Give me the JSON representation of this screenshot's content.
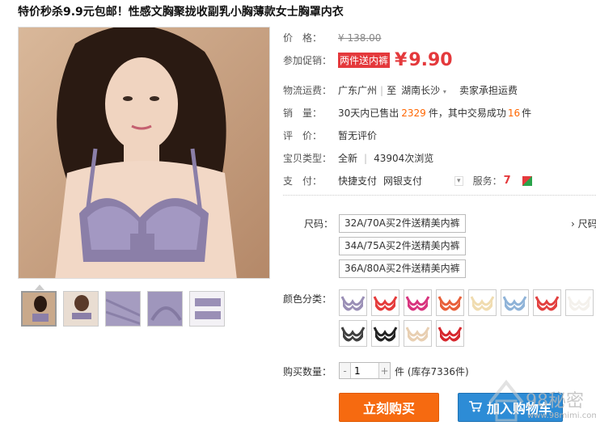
{
  "product": {
    "title": "特价秒杀9.9元包邮！性感文胸聚拢收副乳小胸薄款女士胸罩内衣"
  },
  "price_row": {
    "label": "价　格：",
    "old_price": "¥ 138.00"
  },
  "promo_row": {
    "label": "参加促销：",
    "badge": "两件送内裤",
    "currency": "¥",
    "price": "9.90"
  },
  "shipping_row": {
    "label": "物流运费：",
    "from": "广东广州",
    "to_prefix": "至",
    "to": "湖南长沙",
    "note": "卖家承担运费"
  },
  "sales_row": {
    "label": "销　量：",
    "prefix": "30天内已售出",
    "sold": "2329",
    "mid": "件，其中交易成功",
    "success": "16",
    "suffix": "件"
  },
  "review_row": {
    "label": "评　价：",
    "value": "暂无评价"
  },
  "type_row": {
    "label": "宝贝类型：",
    "value": "全新",
    "views": "43904次浏览"
  },
  "pay_row": {
    "label": "支　付：",
    "methods": [
      "快捷支付",
      "网银支付"
    ],
    "service_label": "服务："
  },
  "size": {
    "label": "尺码：",
    "options": [
      "32A/70A买2件送精美内裤",
      "34A/75A买2件送精美内裤",
      "36A/80A买2件送精美内裤"
    ],
    "side_link": "› 尺码"
  },
  "color": {
    "label": "颜色分类：",
    "swatches": [
      "#9a8fb6",
      "#e53b3b",
      "#d8347e",
      "#e8603a",
      "#f0dcb0",
      "#8fb3d8",
      "#e2403f",
      "#f4f1ec",
      "#3f3f3f",
      "#222222",
      "#e8cfb2",
      "#d6262c"
    ]
  },
  "quantity": {
    "label": "购买数量：",
    "minus": "-",
    "value": "1",
    "plus": "+",
    "unit_stock": "件 (库存7336件)"
  },
  "buttons": {
    "buy_now": "立刻购买",
    "add_cart": "加入购物车"
  },
  "watermark": {
    "text": "98秘密",
    "sub": "www.98mimi.com"
  }
}
